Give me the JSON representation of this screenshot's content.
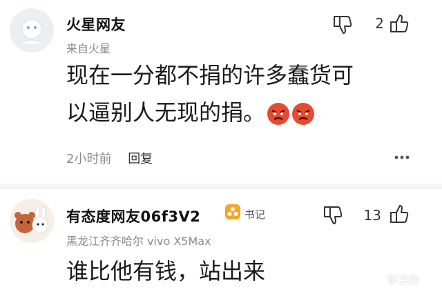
{
  "comments": [
    {
      "username": "火星网友",
      "meta": "来自火星",
      "lines": [
        "现在一分都不捐的许多蠢货可",
        "以逼别人无现的捐。"
      ],
      "emojis": [
        "angry-face-emoji",
        "angry-face-emoji"
      ],
      "like_count": "2",
      "time": "2小时前",
      "reply_label": "回复"
    },
    {
      "username": "有态度网友06f3V2",
      "badge": "书记",
      "meta": "黑龙江齐齐哈尔 vivo X5Max",
      "lines": [
        "谁比他有钱，站出来"
      ],
      "like_count": "13"
    }
  ],
  "watermark": "李洪伙",
  "colors": {
    "badge": "#f5a623",
    "emoji_red": "#e84a2f",
    "divider": "#f4f4f4"
  }
}
